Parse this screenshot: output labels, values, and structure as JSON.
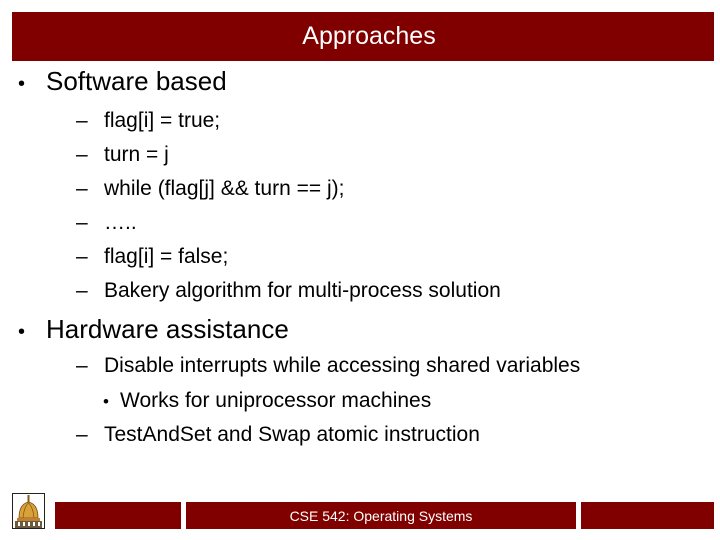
{
  "slide": {
    "title": "Approaches",
    "bullets": [
      {
        "marker": "•",
        "text": "Software based",
        "children": [
          {
            "marker": "–",
            "text": "flag[i] = true;"
          },
          {
            "marker": "–",
            "text": "turn = j"
          },
          {
            "marker": "–",
            "text": "while (flag[j] && turn == j);"
          },
          {
            "marker": "–",
            "text": "….."
          },
          {
            "marker": "–",
            "text": "flag[i] = false;"
          },
          {
            "marker": "–",
            "text": "Bakery algorithm for multi-process solution"
          }
        ]
      },
      {
        "marker": "•",
        "text": "Hardware assistance",
        "children": [
          {
            "marker": "–",
            "text": "Disable interrupts while accessing shared variables",
            "children": [
              {
                "marker": "•",
                "text": "Works for uniprocessor machines"
              }
            ]
          },
          {
            "marker": "–",
            "text": "TestAndSet and Swap atomic instruction"
          }
        ]
      }
    ]
  },
  "footer": {
    "course": "CSE 542: Operating Systems",
    "logo_icon": "golden-dome-icon"
  },
  "colors": {
    "accent": "#800000",
    "text": "#000000",
    "background": "#ffffff"
  }
}
